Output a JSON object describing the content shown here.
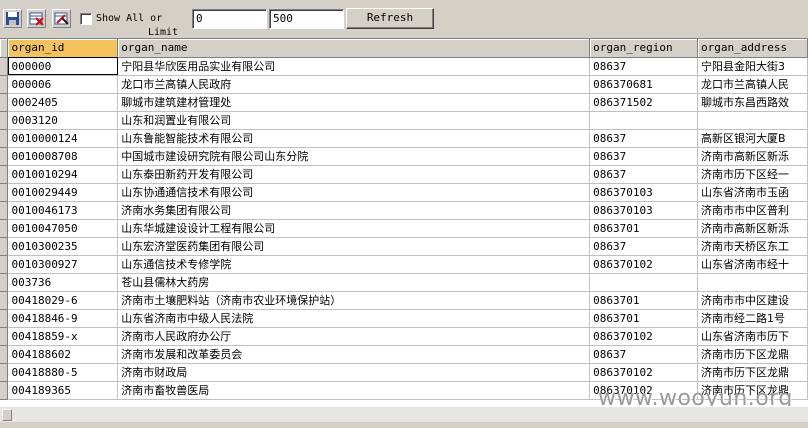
{
  "toolbar": {
    "buttons": [
      {
        "name": "save-icon"
      },
      {
        "name": "delete-table-icon"
      },
      {
        "name": "clear-edit-icon"
      }
    ],
    "show_all_checked": false,
    "show_all_label_line1": "Show All or",
    "show_all_label_line2": "Limit",
    "offset_value": "0",
    "limit_value": "500",
    "refresh_label": "Refresh"
  },
  "grid": {
    "columns": [
      "organ_id",
      "organ_name",
      "organ_region",
      "organ_address"
    ],
    "rows": [
      [
        "000000",
        "宁阳县华欣医用品实业有限公司",
        "08637",
        "宁阳县金阳大街3"
      ],
      [
        "000006",
        "龙口市兰高镇人民政府",
        "086370681",
        "龙口市兰高镇人民"
      ],
      [
        "0002405",
        "聊城市建筑建材管理处",
        "086371502",
        "聊城市东昌西路效"
      ],
      [
        "0003120",
        "山东和润置业有限公司",
        "",
        ""
      ],
      [
        "0010000124",
        "山东鲁能智能技术有限公司",
        "08637",
        "高新区银河大厦B"
      ],
      [
        "0010008708",
        "中国城市建设研究院有限公司山东分院",
        "08637",
        "济南市高新区新泺"
      ],
      [
        "0010010294",
        "山东泰田新药开发有限公司",
        "08637",
        "济南市历下区经一"
      ],
      [
        "0010029449",
        "山东协通通信技术有限公司",
        "086370103",
        "山东省济南市玉函"
      ],
      [
        "0010046173",
        "济南水务集团有限公司",
        "086370103",
        "济南市市中区普利"
      ],
      [
        "0010047050",
        "山东华城建设设计工程有限公司",
        "0863701",
        "济南市高新区新泺"
      ],
      [
        "0010300235",
        "山东宏济堂医药集团有限公司",
        "08637",
        "济南市天桥区东工"
      ],
      [
        "0010300927",
        "山东通信技术专修学院",
        "086370102",
        "山东省济南市经十"
      ],
      [
        "003736",
        "苍山县儒林大药房",
        "",
        ""
      ],
      [
        "00418029-6",
        "济南市土壤肥料站（济南市农业环境保护站）",
        "0863701",
        "济南市市中区建设"
      ],
      [
        "00418846-9",
        "山东省济南市中级人民法院",
        "0863701",
        "济南市经二路1号"
      ],
      [
        "00418859-x",
        "济南市人民政府办公厅",
        "086370102",
        "山东省济南市历下"
      ],
      [
        "004188602",
        "济南市发展和改革委员会",
        "08637",
        "济南市历下区龙鼎"
      ],
      [
        "00418880-5",
        "济南市财政局",
        "086370102",
        "济南市历下区龙鼎"
      ],
      [
        "004189365",
        "济南市畜牧兽医局",
        "086370102",
        "济南市历下区龙鼎"
      ]
    ]
  },
  "watermark": "www.wooyun.org",
  "colors": {
    "active_header": "#f5c35e",
    "chrome": "#d4d0c8"
  }
}
